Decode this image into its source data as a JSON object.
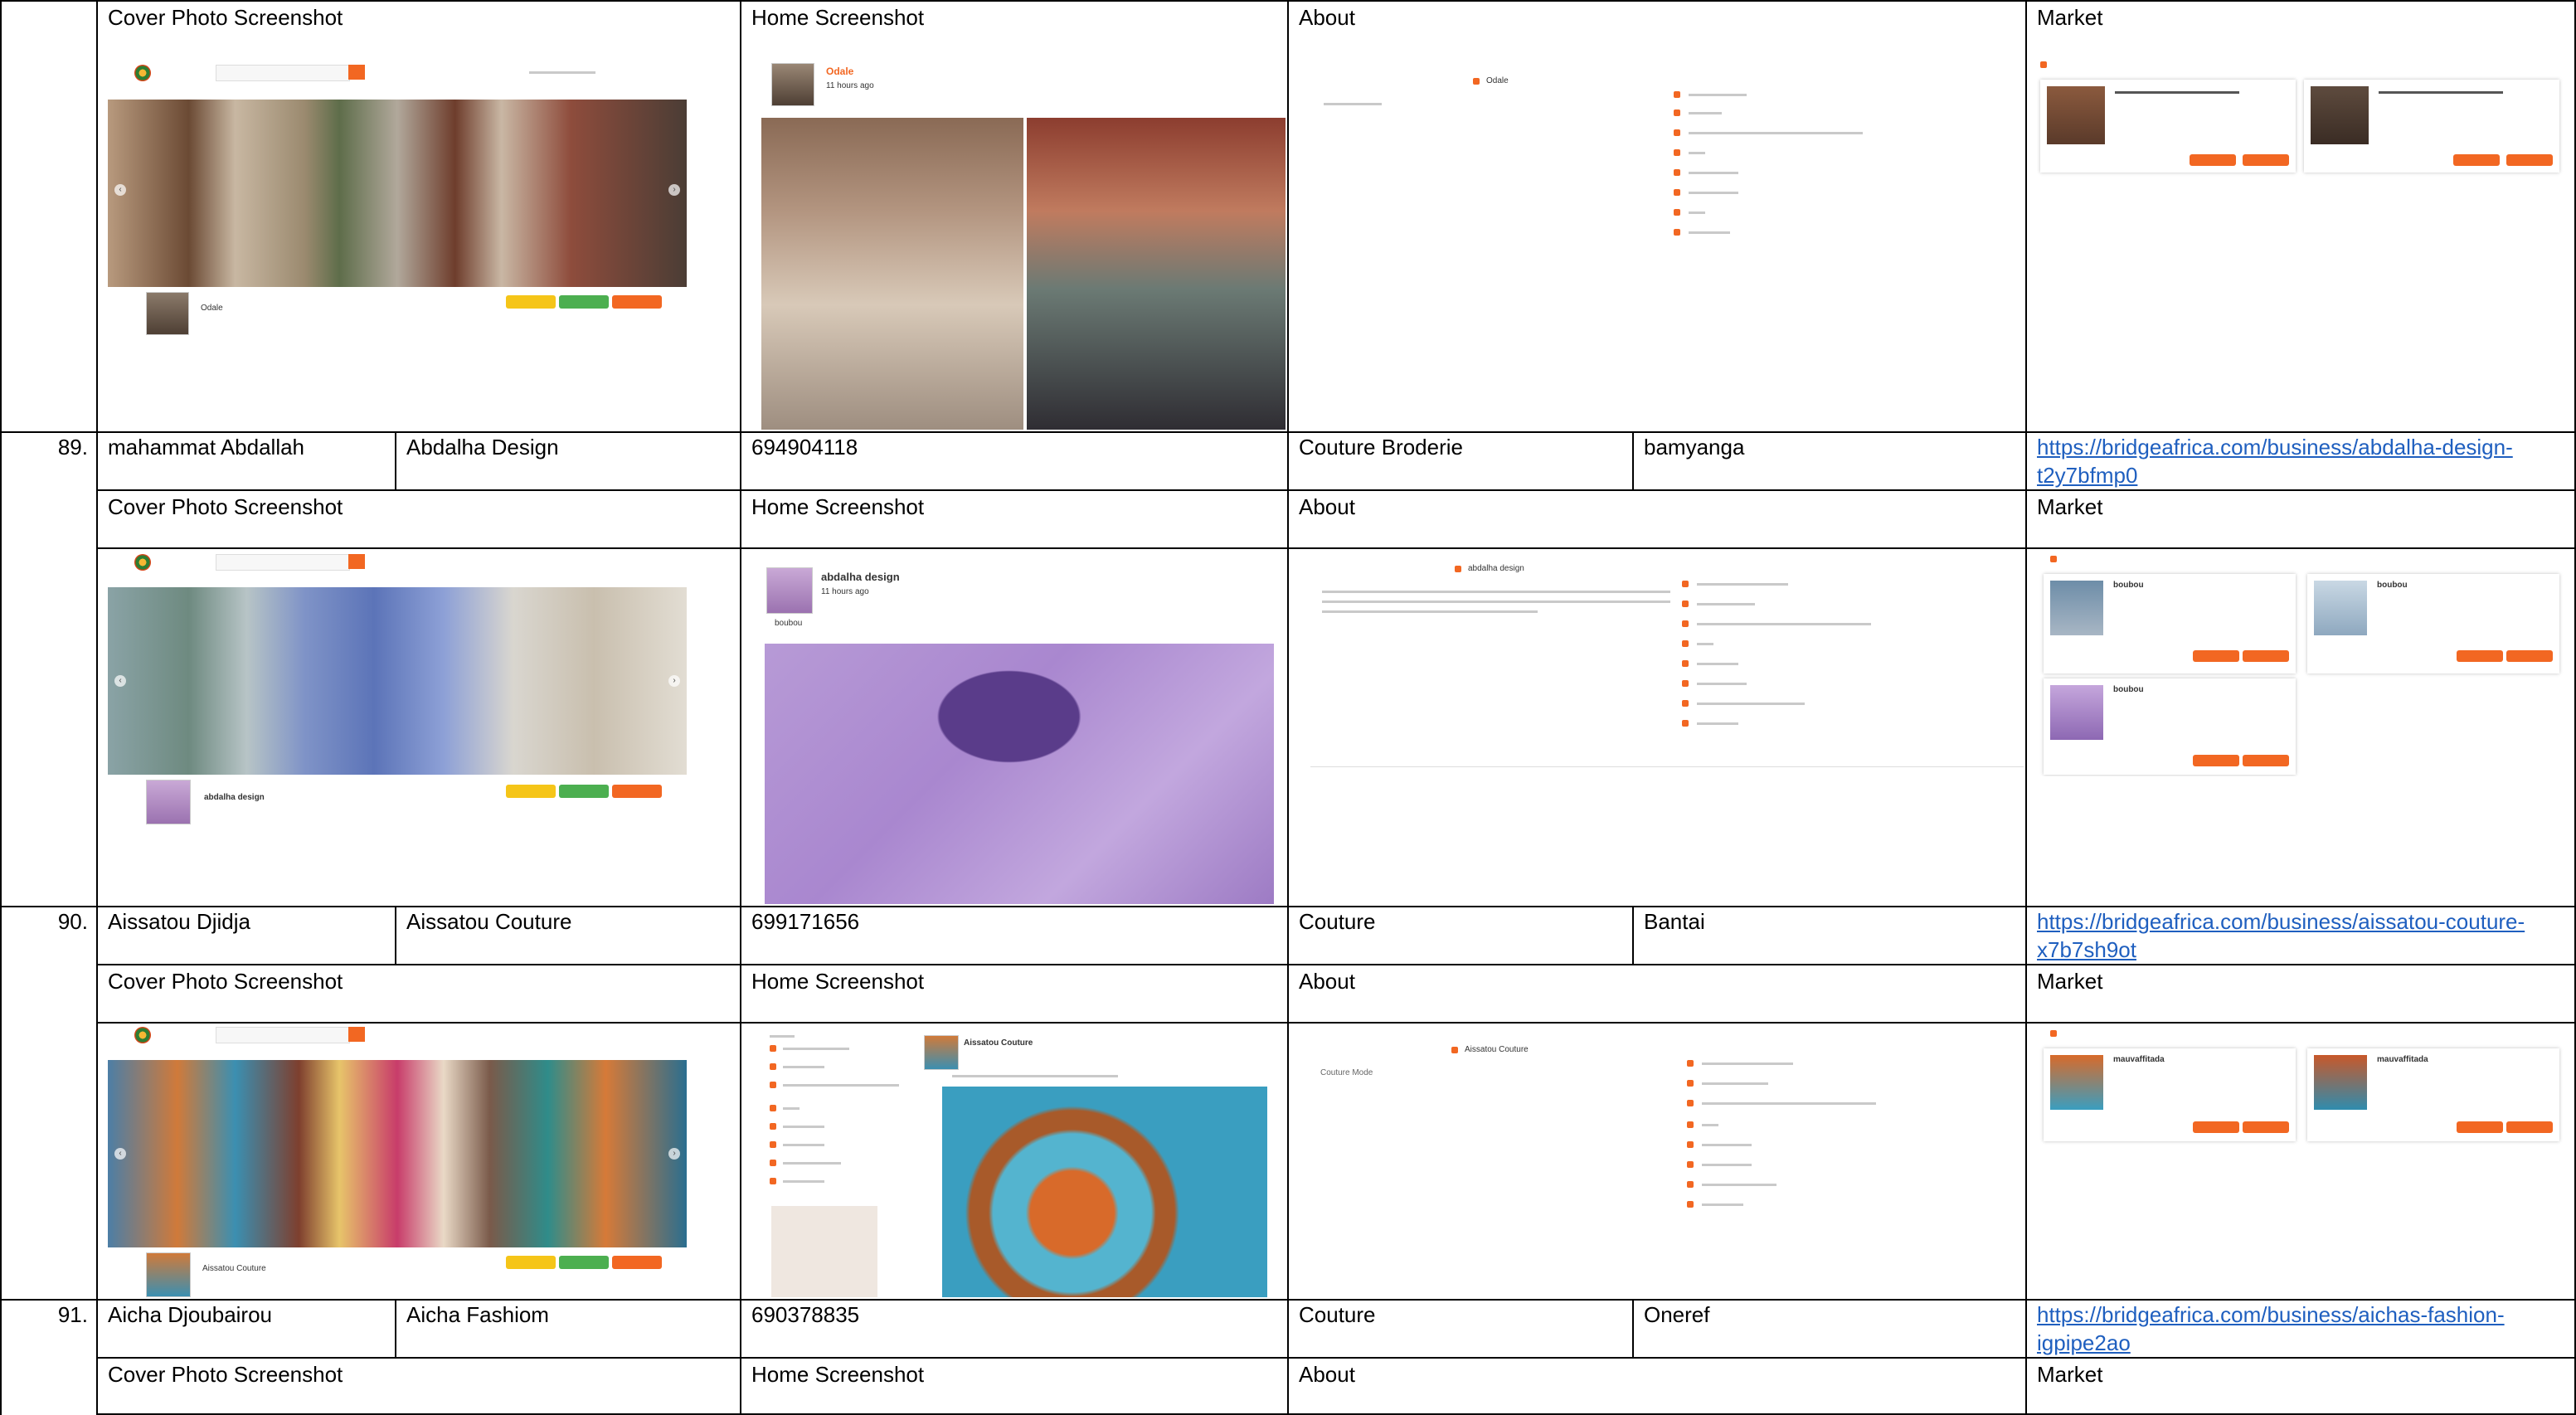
{
  "headers": {
    "cover": "Cover Photo Screenshot",
    "home": "Home Screenshot",
    "about": "About",
    "market": "Market"
  },
  "rows": [
    {
      "number": "89.",
      "owner": "mahammat Abdallah",
      "business": "Abdalha Design",
      "phone": "694904118",
      "category": "Couture Broderie",
      "location": "bamyanga",
      "url": "https://bridgeafrica.com/business/abdalha-design-t2y7bfmp0"
    },
    {
      "number": "90.",
      "owner": "Aissatou Djidja",
      "business": "Aissatou Couture",
      "phone": "699171656",
      "category": "Couture",
      "location": "Bantai",
      "url": "https://bridgeafrica.com/business/aissatou-couture-x7b7sh9ot"
    },
    {
      "number": "91.",
      "owner": "Aicha Djoubairou",
      "business": "Aicha Fashiom",
      "phone": "690378835",
      "category": "Couture",
      "location": "Oneref",
      "url": "https://bridgeafrica.com/business/aichas-fashion-igpipe2ao"
    }
  ],
  "screenshots": {
    "top": {
      "home_name": "Odale",
      "home_time": "11 hours ago",
      "about_name": "Odale",
      "cover_name": "Odale"
    },
    "r89": {
      "home_name": "abdalha design",
      "home_time": "11 hours ago",
      "home_caption": "boubou",
      "about_name": "abdalha design",
      "cover_name": "abdalha design",
      "market_items": [
        "boubou",
        "boubou",
        "boubou"
      ]
    },
    "r90": {
      "home_name": "Aissatou Couture",
      "about_name": "Aissatou Couture",
      "about_sub": "Couture Mode",
      "cover_name": "Aissatou Couture",
      "market_items": [
        "mauvaffitada",
        "mauvaffitada"
      ]
    }
  },
  "colors": {
    "accent": "#f26722",
    "link": "#1f5fbf",
    "rule": "#000000"
  },
  "icons": [
    "bridge-africa-logo-icon",
    "carousel-prev-icon",
    "carousel-next-icon"
  ]
}
